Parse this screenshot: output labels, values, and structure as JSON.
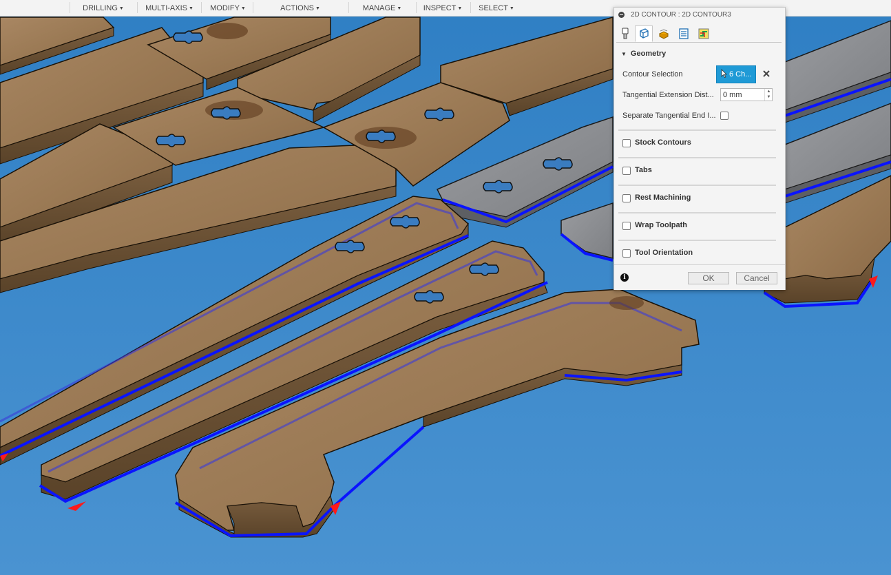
{
  "toolbar": {
    "items": [
      {
        "label": "DRILLING"
      },
      {
        "label": "MULTI-AXIS"
      },
      {
        "label": "MODIFY"
      },
      {
        "label": "ACTIONS"
      },
      {
        "label": "MANAGE"
      },
      {
        "label": "INSPECT"
      },
      {
        "label": "SELECT"
      }
    ]
  },
  "dialog": {
    "title": "2D CONTOUR : 2D CONTOUR3",
    "tabs": [
      {
        "icon": "tool-icon",
        "active": false
      },
      {
        "icon": "geometry-icon",
        "active": true
      },
      {
        "icon": "heights-icon",
        "active": false
      },
      {
        "icon": "passes-icon",
        "active": false
      },
      {
        "icon": "linking-icon",
        "active": false
      }
    ],
    "geometry": {
      "header": "Geometry",
      "contour_selection_label": "Contour Selection",
      "contour_selection_value": "6 Ch...",
      "tangential_extension_label": "Tangential Extension Dist...",
      "tangential_extension_value": "0 mm",
      "separate_tangential_label": "Separate Tangential End I...",
      "separate_tangential_checked": false
    },
    "sections": [
      {
        "label": "Stock Contours",
        "checked": false
      },
      {
        "label": "Tabs",
        "checked": false
      },
      {
        "label": "Rest Machining",
        "checked": false
      },
      {
        "label": "Wrap Toolpath",
        "checked": false
      },
      {
        "label": "Tool Orientation",
        "checked": false
      }
    ],
    "ok_label": "OK",
    "cancel_label": "Cancel"
  },
  "colors": {
    "background": "#3b86c7",
    "wood": "#9a7a56",
    "wood_side": "#6b5237",
    "toolpath_blue": "#0a14ff",
    "selected_part": "#8a8c90",
    "accent": "#1f9ad6",
    "arrow_red": "#ff1a1a"
  }
}
